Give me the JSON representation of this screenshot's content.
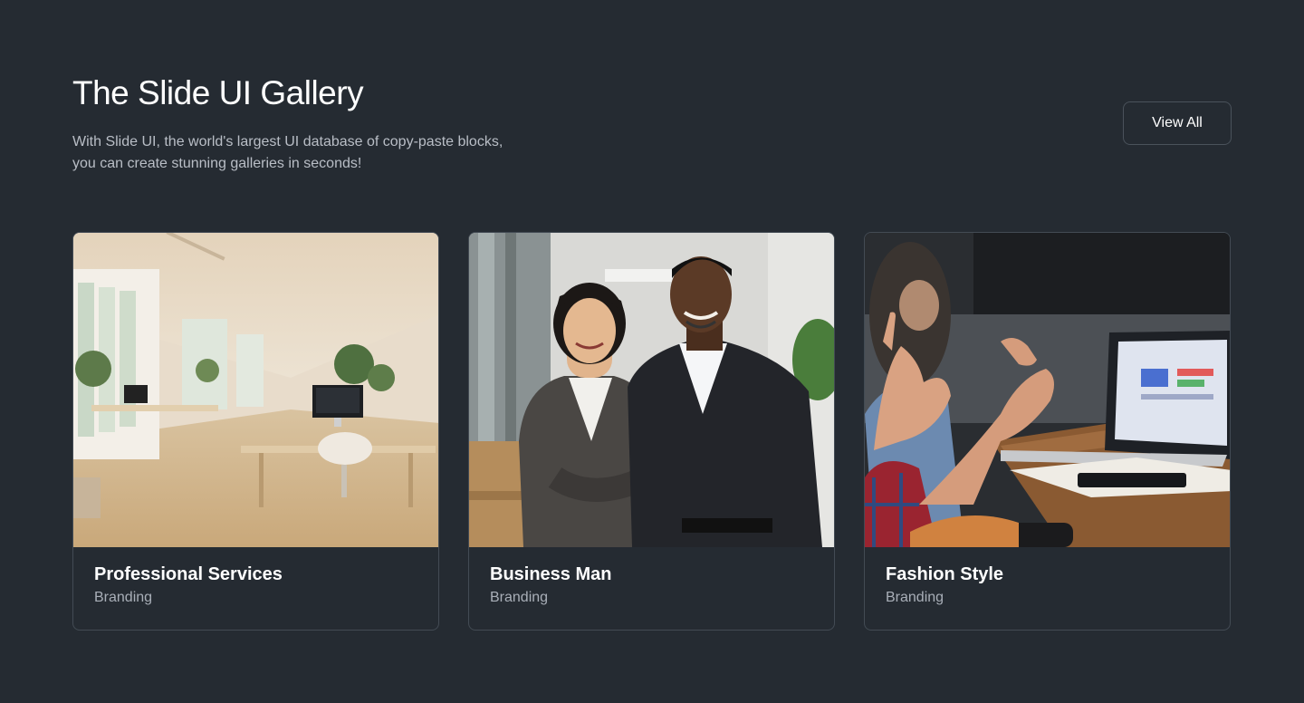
{
  "header": {
    "title": "The Slide UI Gallery",
    "subtitle": "With Slide UI, the world's largest UI database of copy-paste blocks, you can create stunning galleries in seconds!",
    "view_all_label": "View All"
  },
  "cards": [
    {
      "title": "Professional Services",
      "category": "Branding",
      "image": "office-interior-photo"
    },
    {
      "title": "Business Man",
      "category": "Branding",
      "image": "business-people-portrait-photo"
    },
    {
      "title": "Fashion Style",
      "category": "Branding",
      "image": "meeting-laptop-photo"
    }
  ],
  "colors": {
    "background": "#252b32",
    "card_border": "#434b54",
    "muted_text": "#a9afb8"
  }
}
